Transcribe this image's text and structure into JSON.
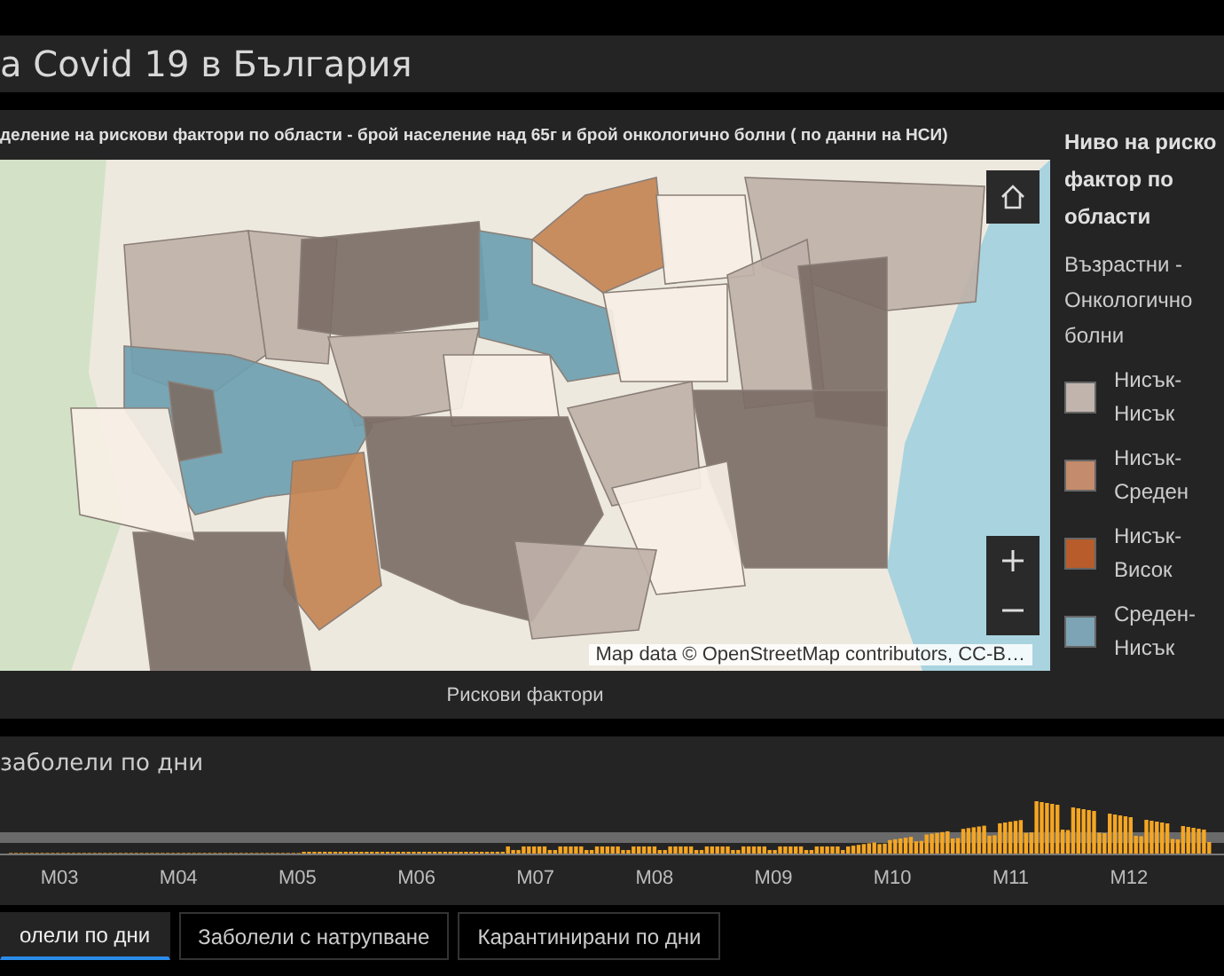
{
  "header": {
    "title": "а Covid 19 в България"
  },
  "map_panel": {
    "heading": "деление на рискови фактори по области - брой население над 65г и брой онкологично болни ( по данни на НСИ)",
    "attribution": "Map data © OpenStreetMap contributors, CC-B…",
    "caption": "Рискови фактори"
  },
  "legend": {
    "title": "Ниво на риско фактор по области",
    "subtitle": "Възрастни - Онкологично болни",
    "items": [
      {
        "label": "Нисък-Нисък",
        "color": "#c0b4ac"
      },
      {
        "label": "Нисък-Среден",
        "color": "#c48c6c"
      },
      {
        "label": "Нисък-Висок",
        "color": "#b85c2c"
      },
      {
        "label": "Среден-Нисък",
        "color": "#7ca4b4"
      }
    ]
  },
  "chart_panel": {
    "title": "заболели по дни",
    "months": [
      "M03",
      "M04",
      "M05",
      "M06",
      "M07",
      "M08",
      "M09",
      "M10",
      "M11",
      "M12"
    ]
  },
  "tabs": [
    {
      "label": "олели по дни",
      "selected": true
    },
    {
      "label": "Заболели с натрупване",
      "selected": false
    },
    {
      "label": "Карантинирани по дни",
      "selected": false
    }
  ]
}
